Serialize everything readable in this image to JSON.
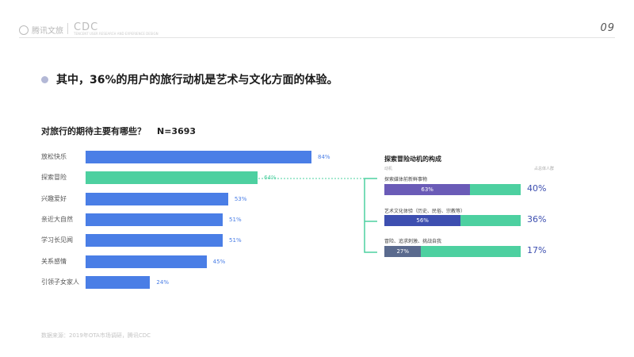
{
  "header": {
    "logo_text": "腾讯文旅",
    "logo_cdc": "CDC",
    "logo_cdc_sub": "TENCENT USER RESEARCH AND EXPERIENCE DESIGN",
    "page_number": "09"
  },
  "headline": "其中，36%的用户的旅行动机是艺术与文化方面的体验。",
  "left_chart": {
    "question": "对旅行的期待主要有哪些？",
    "sample": "N=3693"
  },
  "right_panel": {
    "title": "探索冒险动机的构成",
    "col_left": "动机",
    "col_right": "占总体人群"
  },
  "footer": {
    "source": "数据来源：2019年OTA市场调研，腾讯CDC"
  },
  "colors": {
    "blue": "#4a7ee6",
    "green": "#4dd0a0",
    "purple": "#6a5bb7",
    "slate": "#5a6a8e",
    "indigo": "#3d4fb0"
  },
  "chart_data": [
    {
      "type": "bar",
      "orientation": "horizontal",
      "title": "对旅行的期待主要有哪些？",
      "categories": [
        "放松快乐",
        "探索冒险",
        "兴趣爱好",
        "亲近大自然",
        "学习长见闻",
        "关系感情",
        "引领子女家人"
      ],
      "values": [
        84,
        64,
        53,
        51,
        51,
        45,
        24
      ],
      "value_labels": [
        "84%",
        "64%",
        "53%",
        "51%",
        "51%",
        "45%",
        "24%"
      ],
      "highlight": "探索冒险",
      "xlim": [
        0,
        100
      ],
      "grid": false
    },
    {
      "type": "bar",
      "orientation": "horizontal",
      "stacked": true,
      "title": "探索冒险动机的构成",
      "categories": [
        "探索媒体前新鲜事物",
        "艺术文化体验（历史、民俗、宗教等）",
        "冒险、追求刺激、挑战自我"
      ],
      "inner_values": [
        63,
        56,
        27
      ],
      "inner_labels": [
        "63%",
        "56%",
        "27%"
      ],
      "share_of_total": [
        40,
        36,
        17
      ],
      "share_labels": [
        "40%",
        "36%",
        "17%"
      ],
      "xlim": [
        0,
        100
      ]
    }
  ]
}
